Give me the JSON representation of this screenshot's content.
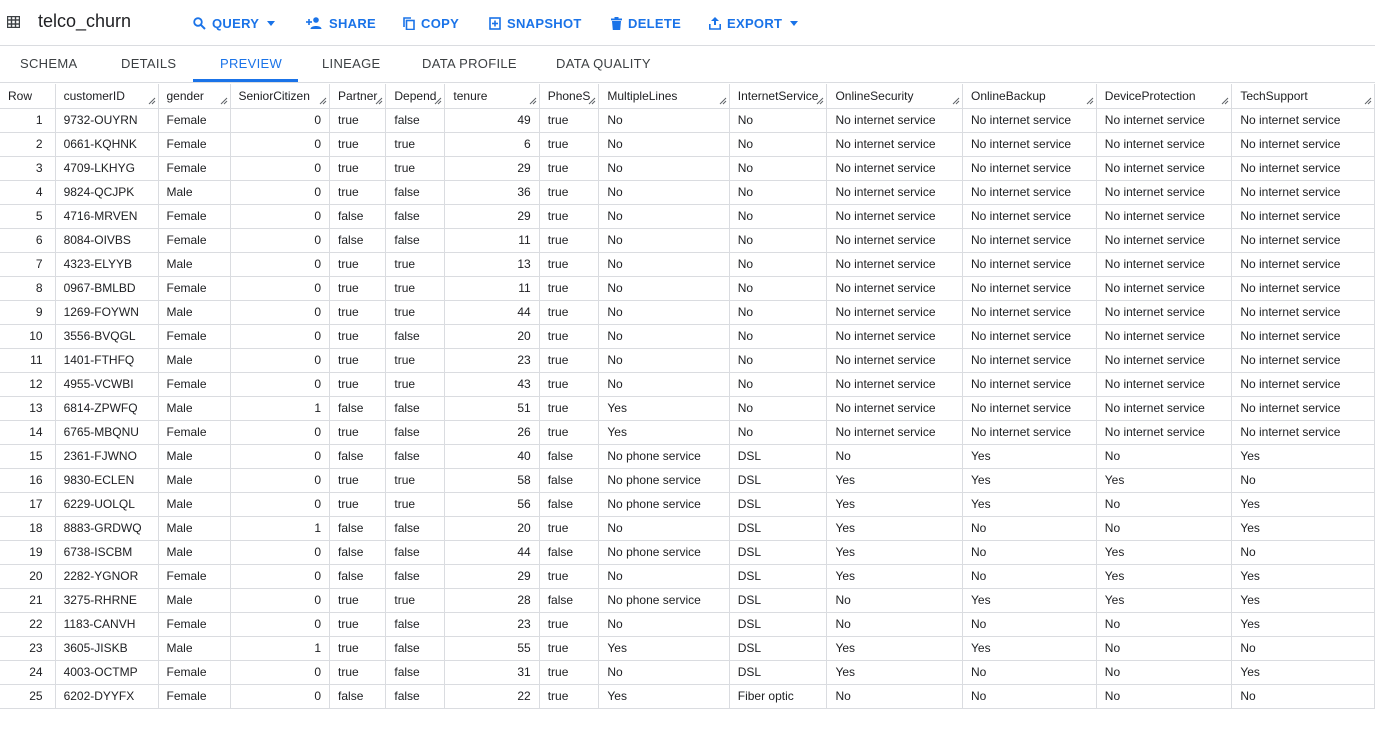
{
  "app": {
    "title": "telco_churn"
  },
  "toolbar": {
    "query": "QUERY",
    "share": "SHARE",
    "copy": "COPY",
    "snapshot": "SNAPSHOT",
    "delete": "DELETE",
    "export": "EXPORT"
  },
  "tabs": [
    "SCHEMA",
    "DETAILS",
    "PREVIEW",
    "LINEAGE",
    "DATA PROFILE",
    "DATA QUALITY"
  ],
  "active_tab": "PREVIEW",
  "colors": {
    "accent": "#1a73e8",
    "border": "#dadce0",
    "text": "#202124"
  },
  "columns": [
    "Row",
    "customerID",
    "gender",
    "SeniorCitizen",
    "Partner",
    "Depend",
    "tenure",
    "PhoneS",
    "MultipleLines",
    "InternetService",
    "OnlineSecurity",
    "OnlineBackup",
    "DeviceProtection",
    "TechSupport"
  ],
  "rows": [
    [
      "1",
      "9732-OUYRN",
      "Female",
      "0",
      "true",
      "false",
      "49",
      "true",
      "No",
      "No",
      "No internet service",
      "No internet service",
      "No internet service",
      "No internet service"
    ],
    [
      "2",
      "0661-KQHNK",
      "Female",
      "0",
      "true",
      "true",
      "6",
      "true",
      "No",
      "No",
      "No internet service",
      "No internet service",
      "No internet service",
      "No internet service"
    ],
    [
      "3",
      "4709-LKHYG",
      "Female",
      "0",
      "true",
      "true",
      "29",
      "true",
      "No",
      "No",
      "No internet service",
      "No internet service",
      "No internet service",
      "No internet service"
    ],
    [
      "4",
      "9824-QCJPK",
      "Male",
      "0",
      "true",
      "false",
      "36",
      "true",
      "No",
      "No",
      "No internet service",
      "No internet service",
      "No internet service",
      "No internet service"
    ],
    [
      "5",
      "4716-MRVEN",
      "Female",
      "0",
      "false",
      "false",
      "29",
      "true",
      "No",
      "No",
      "No internet service",
      "No internet service",
      "No internet service",
      "No internet service"
    ],
    [
      "6",
      "8084-OIVBS",
      "Female",
      "0",
      "false",
      "false",
      "11",
      "true",
      "No",
      "No",
      "No internet service",
      "No internet service",
      "No internet service",
      "No internet service"
    ],
    [
      "7",
      "4323-ELYYB",
      "Male",
      "0",
      "true",
      "true",
      "13",
      "true",
      "No",
      "No",
      "No internet service",
      "No internet service",
      "No internet service",
      "No internet service"
    ],
    [
      "8",
      "0967-BMLBD",
      "Female",
      "0",
      "true",
      "true",
      "11",
      "true",
      "No",
      "No",
      "No internet service",
      "No internet service",
      "No internet service",
      "No internet service"
    ],
    [
      "9",
      "1269-FOYWN",
      "Male",
      "0",
      "true",
      "true",
      "44",
      "true",
      "No",
      "No",
      "No internet service",
      "No internet service",
      "No internet service",
      "No internet service"
    ],
    [
      "10",
      "3556-BVQGL",
      "Female",
      "0",
      "true",
      "false",
      "20",
      "true",
      "No",
      "No",
      "No internet service",
      "No internet service",
      "No internet service",
      "No internet service"
    ],
    [
      "11",
      "1401-FTHFQ",
      "Male",
      "0",
      "true",
      "true",
      "23",
      "true",
      "No",
      "No",
      "No internet service",
      "No internet service",
      "No internet service",
      "No internet service"
    ],
    [
      "12",
      "4955-VCWBI",
      "Female",
      "0",
      "true",
      "true",
      "43",
      "true",
      "No",
      "No",
      "No internet service",
      "No internet service",
      "No internet service",
      "No internet service"
    ],
    [
      "13",
      "6814-ZPWFQ",
      "Male",
      "1",
      "false",
      "false",
      "51",
      "true",
      "Yes",
      "No",
      "No internet service",
      "No internet service",
      "No internet service",
      "No internet service"
    ],
    [
      "14",
      "6765-MBQNU",
      "Female",
      "0",
      "true",
      "false",
      "26",
      "true",
      "Yes",
      "No",
      "No internet service",
      "No internet service",
      "No internet service",
      "No internet service"
    ],
    [
      "15",
      "2361-FJWNO",
      "Male",
      "0",
      "false",
      "false",
      "40",
      "false",
      "No phone service",
      "DSL",
      "No",
      "Yes",
      "No",
      "Yes"
    ],
    [
      "16",
      "9830-ECLEN",
      "Male",
      "0",
      "true",
      "true",
      "58",
      "false",
      "No phone service",
      "DSL",
      "Yes",
      "Yes",
      "Yes",
      "No"
    ],
    [
      "17",
      "6229-UOLQL",
      "Male",
      "0",
      "true",
      "true",
      "56",
      "false",
      "No phone service",
      "DSL",
      "Yes",
      "Yes",
      "No",
      "Yes"
    ],
    [
      "18",
      "8883-GRDWQ",
      "Male",
      "1",
      "false",
      "false",
      "20",
      "true",
      "No",
      "DSL",
      "Yes",
      "No",
      "No",
      "Yes"
    ],
    [
      "19",
      "6738-ISCBM",
      "Male",
      "0",
      "false",
      "false",
      "44",
      "false",
      "No phone service",
      "DSL",
      "Yes",
      "No",
      "Yes",
      "No"
    ],
    [
      "20",
      "2282-YGNOR",
      "Female",
      "0",
      "false",
      "false",
      "29",
      "true",
      "No",
      "DSL",
      "Yes",
      "No",
      "Yes",
      "Yes"
    ],
    [
      "21",
      "3275-RHRNE",
      "Male",
      "0",
      "true",
      "true",
      "28",
      "false",
      "No phone service",
      "DSL",
      "No",
      "Yes",
      "Yes",
      "Yes"
    ],
    [
      "22",
      "1183-CANVH",
      "Female",
      "0",
      "true",
      "false",
      "23",
      "true",
      "No",
      "DSL",
      "No",
      "No",
      "No",
      "Yes"
    ],
    [
      "23",
      "3605-JISKB",
      "Male",
      "1",
      "true",
      "false",
      "55",
      "true",
      "Yes",
      "DSL",
      "Yes",
      "Yes",
      "No",
      "No"
    ],
    [
      "24",
      "4003-OCTMP",
      "Female",
      "0",
      "true",
      "false",
      "31",
      "true",
      "No",
      "DSL",
      "Yes",
      "No",
      "No",
      "Yes"
    ],
    [
      "25",
      "6202-DYYFX",
      "Female",
      "0",
      "false",
      "false",
      "22",
      "true",
      "Yes",
      "Fiber optic",
      "No",
      "No",
      "No",
      "No"
    ]
  ]
}
